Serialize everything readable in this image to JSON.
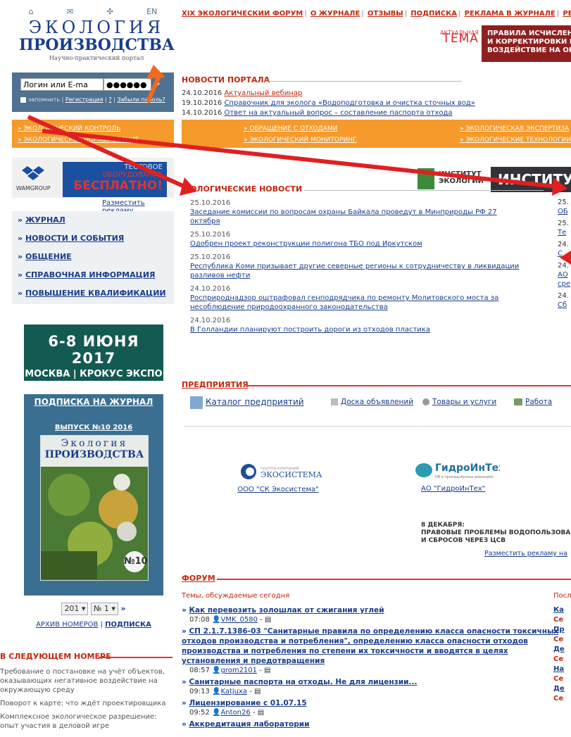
{
  "top_icons": [
    "⌂",
    "✉",
    "✣",
    "EN"
  ],
  "logo": {
    "line1": "ЭКОЛОГИЯ",
    "line2": "ПРОИЗВОДСТВА",
    "subtitle": "Научно-практический портал"
  },
  "login": {
    "login_value": "Логин или E-ma",
    "password_value": "●●●●●●",
    "remember": "запомнить",
    "register": "Регистрация",
    "help": "?",
    "forgot": "Забыли пароль?"
  },
  "topnav": [
    "XIX ЭКОЛОГИЧЕСКИЙ ФОРУМ",
    "О ЖУРНАЛЕ",
    "ОТЗЫВЫ",
    "ПОДПИСКА",
    "РЕКЛАМА В ЖУРНАЛЕ",
    "РЕКЛАМ"
  ],
  "actual_topic": {
    "small": "АКТУАЛЬНАЯ",
    "big": "ТЕМА"
  },
  "red_banner": [
    "ПРАВИЛА ИСЧИСЛЕНИ",
    "И КОРРЕКТИРОВКИ ПЛАТЬ",
    "ВОЗДЕЙСТВИЕ НА ОКРУЖ"
  ],
  "portal_news": {
    "heading": "НОВОСТИ ПОРТАЛА",
    "items": [
      {
        "date": "24.10.2016",
        "text": "Актуальный вебинар"
      },
      {
        "date": "19.10.2016",
        "text": "Справочник для эколога «Водоподготовка и очистка сточных вод»"
      },
      {
        "date": "14.10.2016",
        "text": "Ответ на актуальный вопрос – составление паспорта отхода"
      }
    ]
  },
  "orange_menu": [
    "ЭКОЛОГИЧЕСКИЙ КОНТРОЛЬ",
    "ОБРАЩЕНИЕ С ОТХОДАМИ",
    "ЭКОЛОГИЧЕСКАЯ ЭКСПЕРТИЗА",
    "ЭКОЛОГИЧЕСКОЕ НОРМИРОВАНИЕ",
    "ЭКОЛОГИЧЕСКИЙ МОНИТОРИНГ",
    "ЭКОЛОГИЧЕСКИЕ ТЕХНОЛОГИИ"
  ],
  "banner_left": {
    "brand": "WAMGROUP",
    "l1": "ТЕСТОВОЕ",
    "l2": "ОБОРУДОВАНИЕ",
    "l3": "БЕСПЛАТНО!",
    "place_ad": "Разместить рекламу"
  },
  "institute": {
    "small1": "ИНСТИТУТ",
    "small2": "ЭКОЛОГИИ",
    "big": "ИНСТИТУ"
  },
  "left_nav": [
    "ЖУРНАЛ",
    "НОВОСТИ И СОБЫТИЯ",
    "ОБЩЕНИЕ",
    "СПРАВОЧНАЯ ИНФОРМАЦИЯ",
    "ПОВЫШЕНИЕ КВАЛИФИКАЦИИ"
  ],
  "expo": {
    "dates": "6-8 ИЮНЯ 2017",
    "place": "МОСКВА | КРОКУС ЭКСПО"
  },
  "subscribe": {
    "title": "ПОДПИСКА НА ЖУРНАЛ",
    "issue": "ВЫПУСК №10 2016",
    "cover_l1": "Экология",
    "cover_l2": "ПРОИЗВОДСТВА",
    "cover_num": "№10"
  },
  "selects": {
    "year": "201",
    "num": "№ 1",
    "go": "»"
  },
  "archive": {
    "link1": "АРХИВ НОМЕРОВ",
    "sep": "|",
    "link2": "ПОДПИСКА"
  },
  "next_issue": {
    "heading": "В СЛЕДУЮЩЕМ НОМЕРЕ",
    "items": [
      "Требование о постановке на учёт объектов, оказывающих негативное воздействие на окружающую среду",
      "Поворот к карте: что ждёт проектировщика",
      "Комплексное экологическое разрешение: опыт участия в деловой игре"
    ]
  },
  "eco_news": {
    "heading": "ОЛОГИЧЕСКИЕ НОВОСТИ",
    "items": [
      {
        "date": "25.10.2016",
        "text": "Заседание комиссии по вопросам охраны Байкала проведут в Минприроды РФ 27 октября"
      },
      {
        "date": "25.10.2016",
        "text": "Одобрен проект реконструкции полигона ТБО под Иркутском"
      },
      {
        "date": "25.10.2016",
        "text": "Республика Коми призывает другие северные регионы к сотрудничеству в ликвидации разливов нефти"
      },
      {
        "date": "24.10.2016",
        "text": "Росприроднадзор оштрафовал генподрядчика по ремонту Молитовского моста за несоблюдение природоохранного законодательства"
      },
      {
        "date": "24.10.2016",
        "text": "В Голландии планируют построить дороги из отходов пластика"
      }
    ]
  },
  "right_news": {
    "heading": "Р",
    "items": [
      {
        "d": "25.",
        "t": "ОБ"
      },
      {
        "d": "25.",
        "t": "Те"
      },
      {
        "d": "24.",
        "t": "С"
      },
      {
        "d": "24.",
        "t": "АО"
      },
      {
        "d": "",
        "t": "сре"
      },
      {
        "d": "24.",
        "t": "Сб"
      }
    ]
  },
  "enterprises": {
    "heading": "ПРЕДПРИЯТИЯ",
    "links": [
      "Каталог предприятий",
      "Доска объявлений",
      "Товары и услуги",
      "Работа"
    ],
    "company1": {
      "logo": "ЭКОСИСТЕМА",
      "logo_small": "группа компаний",
      "name": "ООО \"СК Экосистема\""
    },
    "company2": {
      "logo": "ГидроИнТех",
      "logo_small": "НВ в промышленных решениях",
      "name": "АО \"ГидроИнТех\""
    },
    "seminar": [
      "8 ДЕКАБРЯ:",
      "ПРАВОВЫЕ ПРОБЛЕМЫ ВОДОПОЛЬЗОВАН",
      "И СБРОСОВ ЧЕРЕЗ ЦСВ"
    ],
    "place_ad": "Разместить рекламу на"
  },
  "forum": {
    "heading": "ФОРУМ",
    "today": "Темы, обсуждаемые сегодня",
    "last": "Посл",
    "topics": [
      {
        "title": "Как перевозить золошлак от сжигания углей",
        "time": "07:08",
        "user": "VMK_0580"
      },
      {
        "title": "СП 2.1.7.1386-03 \"Санитарные правила по определению класса опасности токсичных отходов производства и потребления\", определению класса опасности отходов производства и потребления по степени их токсичности и вводятся в целях установления и предотвращения",
        "time": "08:57",
        "user": "grom2101"
      },
      {
        "title": "Санитарные паспорта на отходы. Не для лицензии...",
        "time": "09:13",
        "user": "Katjuxa"
      },
      {
        "title": "Лицензирование с 01.07.15",
        "time": "09:52",
        "user": "Anton26"
      },
      {
        "title": "Аккредитация лаборатории",
        "time": "",
        "user": ""
      }
    ],
    "right": [
      {
        "t": "Ка",
        "d": "Се"
      },
      {
        "t": "Пр",
        "d": "Се"
      },
      {
        "t": "Де",
        "d": "Се"
      },
      {
        "t": "На",
        "d": "Се"
      },
      {
        "t": "Де",
        "d": "Се"
      }
    ]
  },
  "colors": {
    "accent": "#c3270e",
    "nav_blue": "#4f7192",
    "orange": "#f59a2b",
    "arrow_red": "#e02020"
  }
}
